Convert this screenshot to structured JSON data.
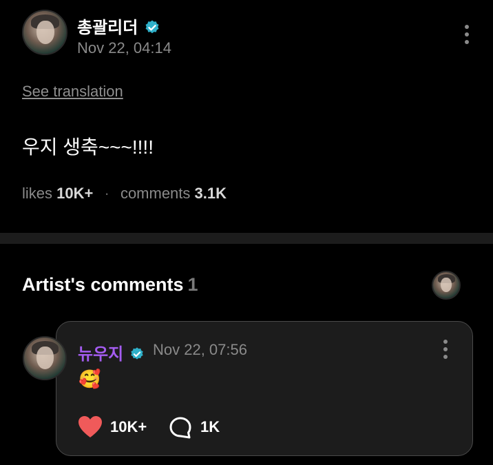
{
  "post": {
    "author_name": "총괄리더",
    "date": "Nov 22, 04:14",
    "see_translation": "See translation",
    "body": "우지 생축~~~!!!!",
    "likes_label": "likes",
    "likes_count": "10K+",
    "comments_label": "comments",
    "comments_count": "3.1K"
  },
  "artist_comments": {
    "title": "Artist's comments",
    "count": "1"
  },
  "comment": {
    "author_name": "뉴우지",
    "date": "Nov 22, 07:56",
    "body": "🥰",
    "like_count": "10K+",
    "reply_count": "1K"
  },
  "colors": {
    "background": "#000000",
    "verified_badge": "#2fb0c9",
    "artist_name": "#a45cf0",
    "heart": "#f05a5a",
    "card_background": "#1c1c1c"
  },
  "icons": [
    "verified-badge-icon",
    "more-options-icon",
    "heart-icon",
    "comment-bubble-icon"
  ]
}
